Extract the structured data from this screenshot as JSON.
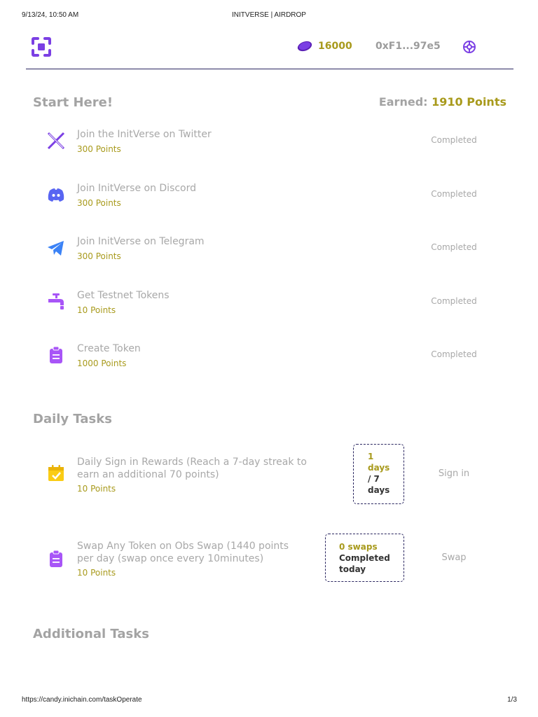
{
  "print": {
    "datetime": "9/13/24, 10:50 AM",
    "title": "INITVERSE | AIRDROP",
    "url": "https://candy.inichain.com/taskOperate",
    "page": "1/3"
  },
  "header": {
    "balance": "16000",
    "wallet": "0xF1...97e5"
  },
  "start": {
    "title": "Start Here!",
    "earned_label": "Earned:",
    "earned_points": "1910 Points",
    "tasks": [
      {
        "name": "Join the InitVerse on Twitter",
        "points": "300 Points",
        "status": "Completed",
        "icon": "x-twitter-icon"
      },
      {
        "name": "Join InitVerse on Discord",
        "points": "300 Points",
        "status": "Completed",
        "icon": "discord-icon"
      },
      {
        "name": "Join InitVerse on Telegram",
        "points": "300 Points",
        "status": "Completed",
        "icon": "telegram-icon"
      },
      {
        "name": "Get Testnet Tokens",
        "points": "10 Points",
        "status": "Completed",
        "icon": "faucet-icon"
      },
      {
        "name": "Create Token",
        "points": "1000 Points",
        "status": "Completed",
        "icon": "clipboard-icon"
      }
    ]
  },
  "daily": {
    "title": "Daily Tasks",
    "tasks": [
      {
        "name_line1": "Daily Sign in Rewards (Reach a 7-day streak to",
        "name_line2": "earn an additional 70 points)",
        "points": "10 Points",
        "counter_current": "1",
        "counter_days": "days",
        "counter_total": "/ 7",
        "counter_total_days": "days",
        "action": "Sign in",
        "icon": "calendar-check-icon"
      },
      {
        "name_line1": "Swap Any Token on Obs Swap (1440 points",
        "name_line2": "per day (swap once every 10minutes)",
        "points": "10 Points",
        "counter_swaps": "0 swaps",
        "counter_completed": "Completed",
        "counter_today": "today",
        "action": "Swap",
        "icon": "clipboard-icon"
      }
    ]
  },
  "additional": {
    "title": "Additional Tasks"
  },
  "colors": {
    "accent_purple": "#7b3fe4",
    "gold": "#a89a1c",
    "navy": "#2a2660"
  }
}
